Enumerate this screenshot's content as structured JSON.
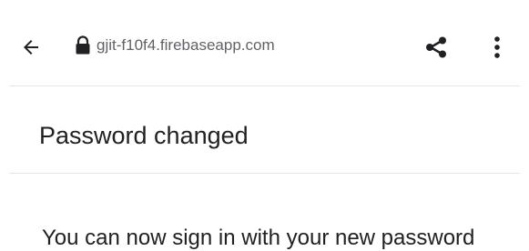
{
  "browser": {
    "url": "gjit-f10f4.firebaseapp.com",
    "icons": {
      "back": "arrow-back-icon",
      "lock": "lock-icon",
      "share": "share-icon",
      "menu": "more-vert-icon"
    }
  },
  "page": {
    "title": "Password changed",
    "message": "You can now sign in with your new password"
  }
}
